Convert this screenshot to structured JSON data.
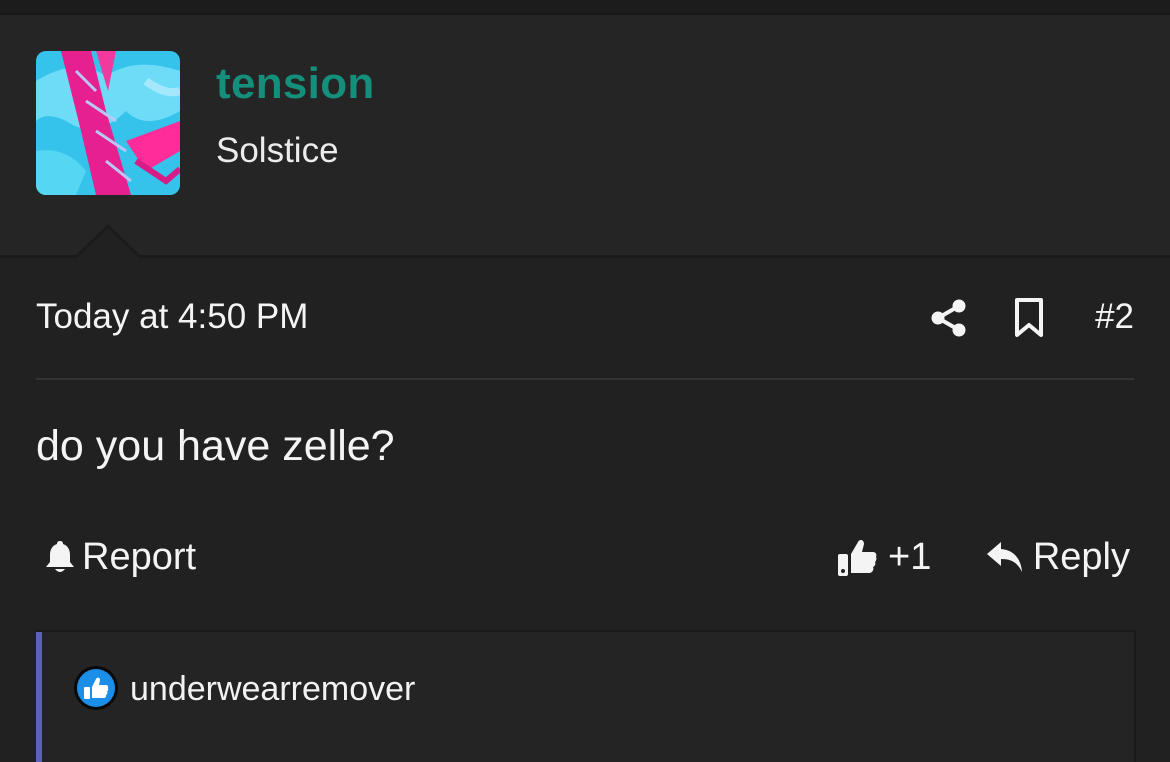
{
  "user": {
    "name": "tension",
    "title": "Solstice",
    "name_color": "#138f7b",
    "avatar_icon": "avatar-image"
  },
  "post": {
    "timestamp": "Today at 4:50 PM",
    "number": "#2",
    "message": "do you have zelle?",
    "share_icon": "share-icon",
    "bookmark_icon": "bookmark-icon"
  },
  "actions": {
    "report_label": "Report",
    "like_label": "+1",
    "reply_label": "Reply",
    "report_icon": "bell-icon",
    "like_icon": "thumbs-up-icon",
    "reply_icon": "reply-arrow-icon"
  },
  "reactions": {
    "users": "underwearremover",
    "accent_color": "#5a63b8",
    "reaction_icon": "like-reaction-icon"
  }
}
